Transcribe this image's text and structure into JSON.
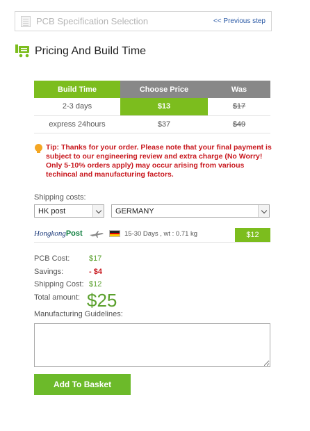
{
  "header": {
    "title": "PCB Specification Selection",
    "previous_step": "<< Previous step"
  },
  "section": {
    "title": "Pricing And Build Time"
  },
  "pricing_table": {
    "headers": [
      "Build Time",
      "Choose Price",
      "Was"
    ],
    "rows": [
      {
        "build_time": "2-3 days",
        "price": "$13",
        "was": "$17",
        "selected": true
      },
      {
        "build_time": "express 24hours",
        "price": "$37",
        "was": "$49",
        "selected": false
      }
    ]
  },
  "tip": {
    "text": "Tip: Thanks for your order. Please note that your final payment is subject to our engineering review and extra charge (No Worry! Only 5-10% orders apply) may occur arising from various techincal and manufacturing factors."
  },
  "shipping": {
    "label": "Shipping costs:",
    "carrier": "HK post",
    "country": "GERMANY",
    "carrier_logo_text": "Hongkong",
    "carrier_logo_bold": "Post",
    "info": "15-30 Days ,   wt : 0.71 kg",
    "price": "$12"
  },
  "summary": {
    "pcb_cost_label": "PCB Cost:",
    "pcb_cost": "$17",
    "savings_label": "Savings:",
    "savings": "- $4",
    "shipping_label": "Shipping Cost:",
    "shipping": "$12",
    "total_label": "Total amount:",
    "total": "$25"
  },
  "guidelines": {
    "label": "Manufacturing Guidelines:",
    "value": ""
  },
  "actions": {
    "add_to_basket": "Add To Basket"
  },
  "colors": {
    "accent_green": "#7cbd1e",
    "header_gray": "#888888",
    "tip_red": "#c8181e",
    "link_blue": "#2b5aa6"
  }
}
